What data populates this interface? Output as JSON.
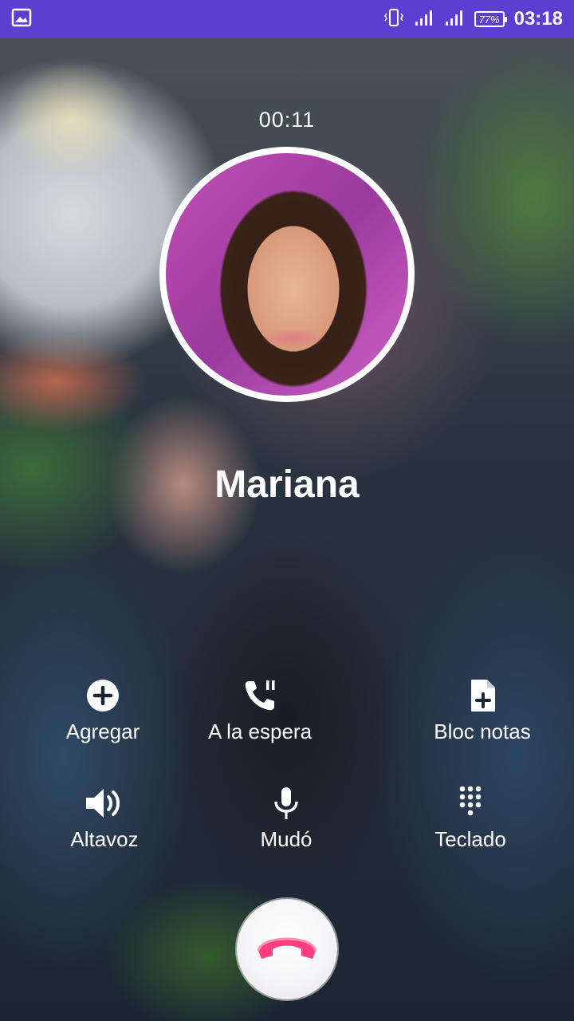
{
  "status_bar": {
    "battery": "77%",
    "time": "03:18",
    "accent_color": "#5b3fd0"
  },
  "call": {
    "timer": "00:11",
    "contact_name": "Mariana"
  },
  "actions": {
    "add": "Agregar",
    "hold": "A la espera",
    "notes": "Bloc notas",
    "speaker": "Altavoz",
    "mute": "Mudó",
    "keypad": "Teclado"
  },
  "icons": {
    "gallery": "image-icon",
    "vibrate": "vibrate-icon",
    "signal": "signal-icon",
    "add": "plus-circle-icon",
    "hold": "phone-pause-icon",
    "notes": "file-plus-icon",
    "speaker": "volume-icon",
    "mute": "microphone-icon",
    "keypad": "dialpad-icon",
    "end_call": "phone-hangup-icon"
  },
  "colors": {
    "end_call": "#ff3d7f"
  }
}
